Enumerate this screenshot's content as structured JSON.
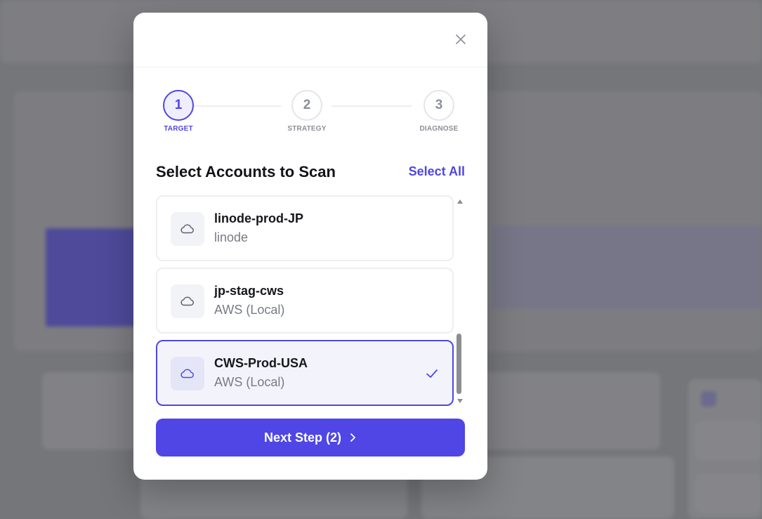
{
  "colors": {
    "accent": "#4f46e5",
    "accent_light": "#efeefc",
    "muted_text": "#777b84",
    "border": "#eceef1"
  },
  "modal": {
    "close_icon": "close-icon",
    "steps": [
      {
        "number": "1",
        "label": "TARGET",
        "active": true
      },
      {
        "number": "2",
        "label": "STRATEGY",
        "active": false
      },
      {
        "number": "3",
        "label": "DIAGNOSE",
        "active": false
      }
    ],
    "section_title": "Select Accounts to Scan",
    "select_all_label": "Select All",
    "accounts": [
      {
        "name": "linode-prod-JP",
        "provider": "linode",
        "icon": "cloud-icon",
        "selected": false
      },
      {
        "name": "jp-stag-cws",
        "provider": "AWS (Local)",
        "icon": "cloud-icon",
        "selected": false
      },
      {
        "name": "CWS-Prod-USA",
        "provider": "AWS (Local)",
        "icon": "cloud-icon",
        "selected": true
      }
    ],
    "next_button_label": "Next Step (2)"
  }
}
